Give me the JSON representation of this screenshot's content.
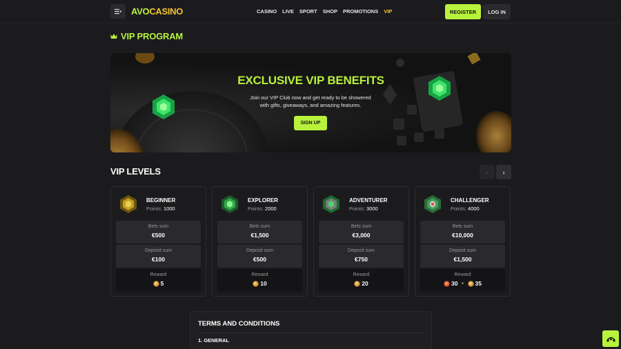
{
  "header": {
    "logo_a": "AVO",
    "logo_b": "CASINO",
    "nav": [
      "CASINO",
      "LIVE",
      "SPORT",
      "SHOP",
      "PROMOTIONS",
      "VIP"
    ],
    "active_nav": "VIP",
    "register_label": "REGISTER",
    "login_label": "LOG IN"
  },
  "page_title": "VIP PROGRAM",
  "banner": {
    "title": "EXCLUSIVE VIP BENEFITS",
    "description": "Join our VIP Club now and get ready to be showered with gifts, giveaways, and amazing features.",
    "signup_label": "SIGN UP"
  },
  "levels": {
    "title": "VIP LEVELS",
    "prev_icon": "‹",
    "next_icon": "›",
    "cards": [
      {
        "name": "BEGINNER",
        "points_label": "Points:",
        "points": "1000",
        "bets_label": "Bets sum",
        "bets": "€500",
        "deposit_label": "Deposit sum",
        "deposit": "€100",
        "reward_label": "Reward",
        "reward": "5",
        "reward_extra": ""
      },
      {
        "name": "EXPLORER",
        "points_label": "Points:",
        "points": "2000",
        "bets_label": "Bets sum",
        "bets": "€1,500",
        "deposit_label": "Deposit sum",
        "deposit": "€500",
        "reward_label": "Reward",
        "reward": "10",
        "reward_extra": ""
      },
      {
        "name": "ADVENTURER",
        "points_label": "Points:",
        "points": "3000",
        "bets_label": "Bets sum",
        "bets": "€3,000",
        "deposit_label": "Deposit sum",
        "deposit": "€750",
        "reward_label": "Reward",
        "reward": "20",
        "reward_extra": ""
      },
      {
        "name": "CHALLENGER",
        "points_label": "Points:",
        "points": "4000",
        "bets_label": "Bets sum",
        "bets": "€10,000",
        "deposit_label": "Deposit sum",
        "deposit": "€1,500",
        "reward_label": "Reward",
        "reward": "30",
        "reward_extra": "35"
      }
    ]
  },
  "terms": {
    "title": "TERMS AND CONDITIONS",
    "section1": "1. GENERAL"
  },
  "colors": {
    "accent": "#b8f23c",
    "gold": "#f5c233",
    "background": "#1b1b1e"
  },
  "icons": {
    "menu": "menu-icon",
    "crown": "crown-icon",
    "coin": "coin-icon",
    "chat": "chat-icon"
  }
}
